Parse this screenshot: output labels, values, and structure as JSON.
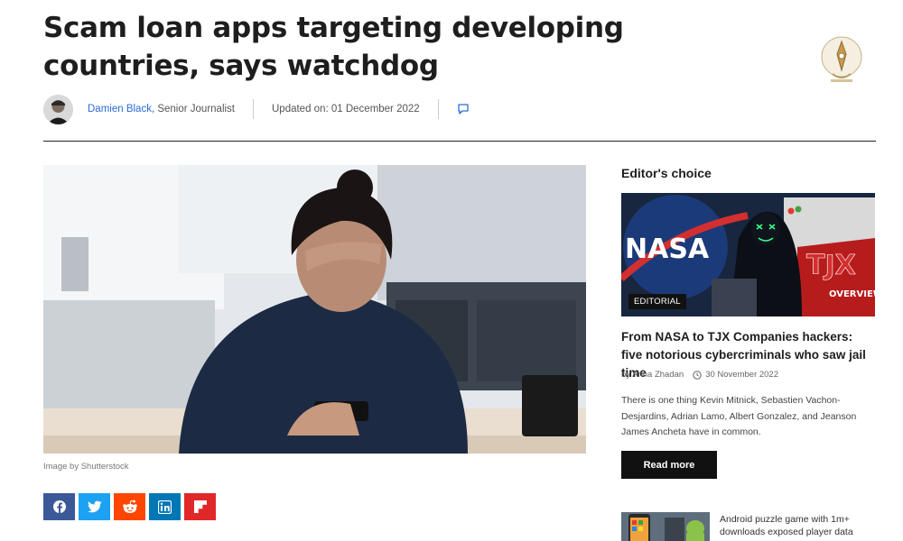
{
  "article": {
    "title": "Scam loan apps targeting developing countries, says watchdog",
    "author_name": "Damien Black",
    "author_role": ", Senior Journalist",
    "updated": "Updated on: 01 December 2022",
    "image_credit": "Image by Shutterstock"
  },
  "share": {
    "buttons": [
      {
        "name": "facebook-icon",
        "color": "#3b5998"
      },
      {
        "name": "twitter-icon",
        "color": "#1da1f2"
      },
      {
        "name": "reddit-icon",
        "color": "#ff4500"
      },
      {
        "name": "linkedin-icon",
        "color": "#0077b5"
      },
      {
        "name": "flipboard-icon",
        "color": "#e12828"
      }
    ]
  },
  "sidebar": {
    "heading": "Editor's choice",
    "featured": {
      "tag": "EDITORIAL",
      "title": "From NASA to TJX Companies hackers: five notorious cybercriminals who saw jail time",
      "by": "by Anna Zhadan",
      "date": "30 November 2022",
      "excerpt": "There is one thing Kevin Mitnick, Sebastien Vachon-Desjardins, Adrian Lamo, Albert Gonzalez, and Jeanson James Ancheta have in common.",
      "read_more": "Read more",
      "image_text_nasa": "NASA",
      "image_text_tjx": "TJX",
      "image_text_overview": "OVERVIEW"
    },
    "next": {
      "title": "Android puzzle game with 1m+ downloads exposed player data"
    }
  },
  "colors": {
    "link": "#2b6cd6",
    "accent": "#111111"
  }
}
